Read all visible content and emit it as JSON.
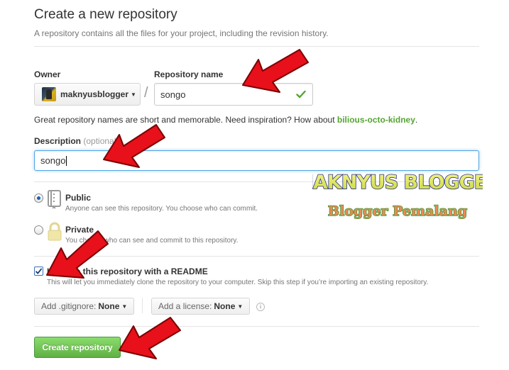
{
  "header": {
    "title": "Create a new repository",
    "subtitle": "A repository contains all the files for your project, including the revision history."
  },
  "form": {
    "owner_label": "Owner",
    "owner_value": "maknyusblogger",
    "separator": "/",
    "repo_name_label": "Repository name",
    "repo_name_value": "songo",
    "hint_text": "Great repository names are short and memorable. Need inspiration? How about ",
    "hint_suggestion": "bilious-octo-kidney",
    "hint_end": ".",
    "description_label": "Description",
    "description_optional": "(optional)",
    "description_value": "songo"
  },
  "visibility": {
    "public_title": "Public",
    "public_desc": "Anyone can see this repository. You choose who can commit.",
    "private_title": "Private",
    "private_desc": "You choose who can see and commit to this repository.",
    "selected": "public"
  },
  "init": {
    "readme_label": "Initialize this repository with a README",
    "readme_desc": "This will let you immediately clone the repository to your computer. Skip this step if you’re importing an existing repository.",
    "readme_checked": true
  },
  "dropdowns": {
    "gitignore_prefix": "Add .gitignore:",
    "gitignore_value": "None",
    "license_prefix": "Add a license:",
    "license_value": "None"
  },
  "submit_label": "Create repository",
  "watermark": {
    "line1": "MAKNYUS BLOGGER",
    "line2": "Blogger Pemalang"
  },
  "colors": {
    "accent_green": "#60b044",
    "suggestion_green": "#55a532",
    "focus_blue": "#51a7e8",
    "arrow_red": "#e8101a"
  },
  "icons": {
    "avatar": "avatar",
    "check": "check-icon",
    "public_repo": "repo-icon",
    "private_repo": "lock-icon",
    "info": "info-icon",
    "annotation_arrow": "red-arrow"
  }
}
